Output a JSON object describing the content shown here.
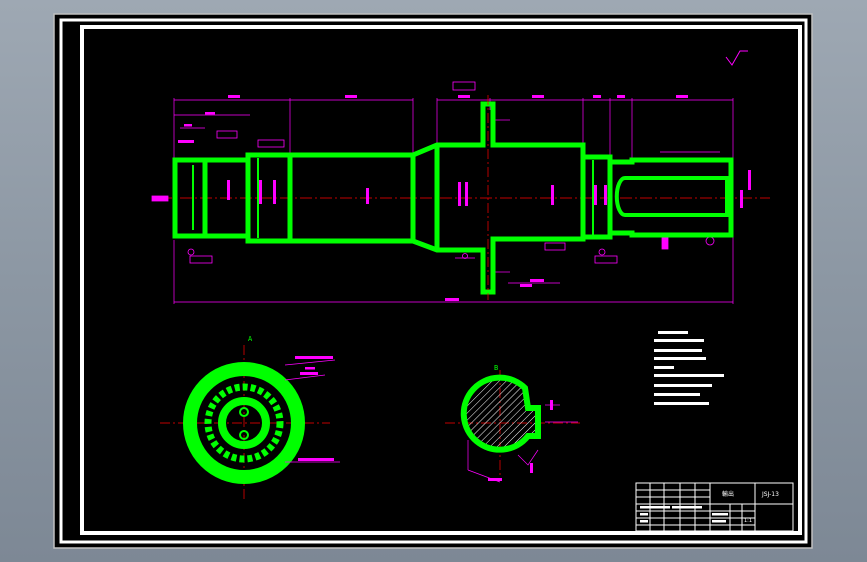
{
  "colors": {
    "background": "#000000",
    "part_outline": "#00ff00",
    "dimension": "#ff00ff",
    "centerline": "#ff0000",
    "frame": "#ffffff",
    "section_hatch": "#ffffff"
  },
  "labels": {
    "section_a": "A",
    "section_b": "B"
  },
  "title_block": {
    "part_name": "輸出",
    "drawing_number": "JSJ-13",
    "scale": "1:1"
  }
}
